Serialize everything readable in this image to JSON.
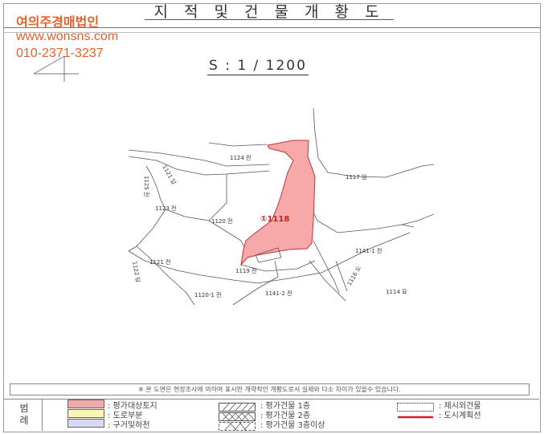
{
  "title": "지 적 및 건 물 개 황 도",
  "watermark": {
    "company": "여의주경매법인",
    "website": "www.wonsns.com",
    "phone": "010-2371-3237"
  },
  "scale_label": "S : 1 / 1200",
  "subject_label": "①1118",
  "parcels": [
    {
      "id": "p1124",
      "label": "1124 전"
    },
    {
      "id": "p1117",
      "label": "1117 임"
    },
    {
      "id": "p1125",
      "label": "1125 전"
    },
    {
      "id": "p1121r",
      "label": "1121 답"
    },
    {
      "id": "p1123",
      "label": "1123 전"
    },
    {
      "id": "p1120",
      "label": "1120 전"
    },
    {
      "id": "p1121",
      "label": "1121 전"
    },
    {
      "id": "p1141_1",
      "label": "1141-1 전"
    },
    {
      "id": "p1122",
      "label": "1122 답"
    },
    {
      "id": "p1119",
      "label": "1119 전"
    },
    {
      "id": "p1120_1",
      "label": "1120-1 전"
    },
    {
      "id": "p1141_2",
      "label": "1141-2 전"
    },
    {
      "id": "p1116",
      "label": "1116 도"
    },
    {
      "id": "p1114",
      "label": "1114 묘"
    }
  ],
  "notice": "※ 본 도면은 현장조사에 의하여 표시한 개략적인 개황도로서 실제와 다소 차이가 있을수 있습니다.",
  "legend": {
    "heading": "범 례",
    "items": [
      {
        "label": ": 평가대상토지",
        "color": "#f4a9a9"
      },
      {
        "label": ": 도로부분",
        "color": "#fbf4b4"
      },
      {
        "label": ": 구거및하천",
        "color": "#d7d8f4"
      },
      {
        "label": ": 평가건물 1층"
      },
      {
        "label": ": 평가건물 2층"
      },
      {
        "label": ": 평가건물 3층이상"
      },
      {
        "label": ": 제시외건물"
      },
      {
        "label": ": 도시계획선",
        "color": "#d0202a"
      }
    ]
  },
  "colors": {
    "subject_fill": "#f7a8a8",
    "subject_stroke": "#c03535",
    "accent": "#e8602a"
  }
}
